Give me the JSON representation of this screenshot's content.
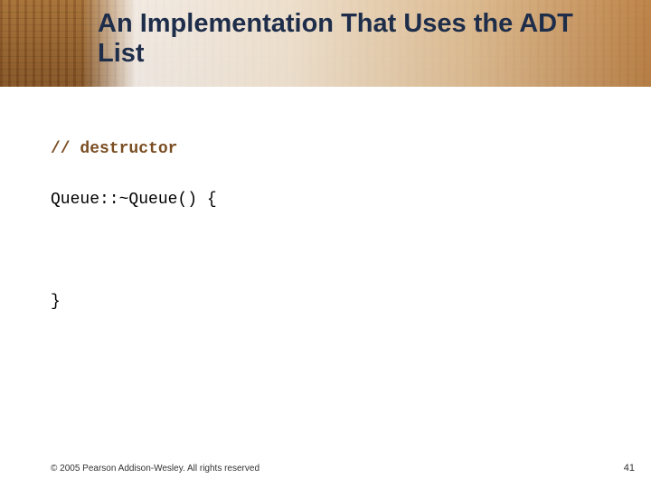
{
  "title": "An Implementation That Uses the ADT List",
  "code": {
    "comment": "// destructor",
    "line1": "Queue::~Queue() {",
    "line2": "}"
  },
  "footer": {
    "copyright": "© 2005 Pearson Addison-Wesley. All rights reserved",
    "page": "41"
  }
}
